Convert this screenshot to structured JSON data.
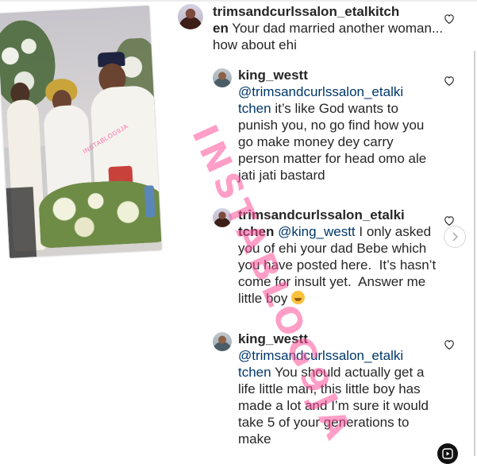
{
  "post": {
    "photo_tag": "INSTABLOG9JA"
  },
  "watermark": {
    "text": "INSTABLOG9JA"
  },
  "comments": [
    {
      "username": "trimsandcurlssalon_etalkitch",
      "username_cont": "en",
      "body": " Your dad married another woman... how about ehi"
    },
    {
      "username": "king_westt",
      "mention": "@trimsandcurlssalon_etalki tchen",
      "body": " it’s like God wants to punish you, no go find how you go make money dey carry person matter for head omo ale jati jati bastard"
    },
    {
      "username": "trimsandcurlssalon_etalki",
      "username_cont": "tchen",
      "mention": "@king_westt",
      "body": " I only asked you of ehi your dad Bebe which you have posted here.  It’s hasn’t come for insult yet.  Answer me little boy"
    },
    {
      "username": "king_westt",
      "mention": "@trimsandcurlssalon_etalki tchen",
      "body": " You should actually get a life little man, this little boy has made a lot and I’m sure it would take 5 of your generations to make"
    }
  ],
  "icons": {
    "like": "heart-outline-icon",
    "next": "chevron-right-icon",
    "reels": "reels-icon",
    "emoji": "smiling-face-emoji"
  },
  "colors": {
    "text": "#262626",
    "mention": "#00376b",
    "watermark": "#ff4f9a"
  }
}
